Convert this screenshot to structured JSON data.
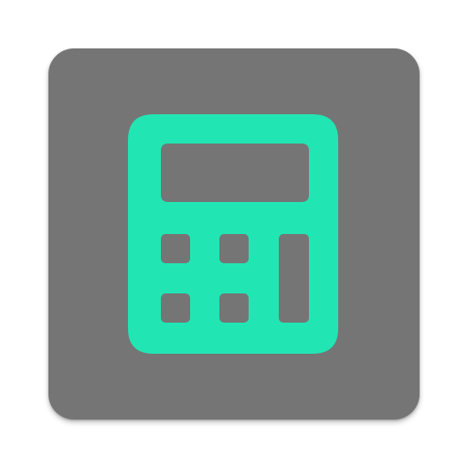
{
  "app_icon": {
    "icon": "calculator-icon",
    "colors": {
      "tile_background": "#757575",
      "glyph": "#21E6B4"
    }
  }
}
